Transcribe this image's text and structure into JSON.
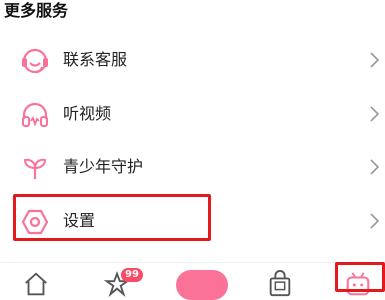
{
  "section": {
    "title": "更多服务"
  },
  "items": [
    {
      "label": "联系客服",
      "icon": "headset-icon"
    },
    {
      "label": "听视频",
      "icon": "headphones-icon"
    },
    {
      "label": "青少年守护",
      "icon": "sprout-icon"
    },
    {
      "label": "设置",
      "icon": "gear-hexagon-icon"
    }
  ],
  "tabbar": {
    "badge": "99",
    "tabs": [
      "home-icon",
      "dynamic-icon",
      "publish-button",
      "shop-icon",
      "mine-icon"
    ]
  },
  "colors": {
    "accent": "#fb7299",
    "highlight": "#e2191d"
  }
}
